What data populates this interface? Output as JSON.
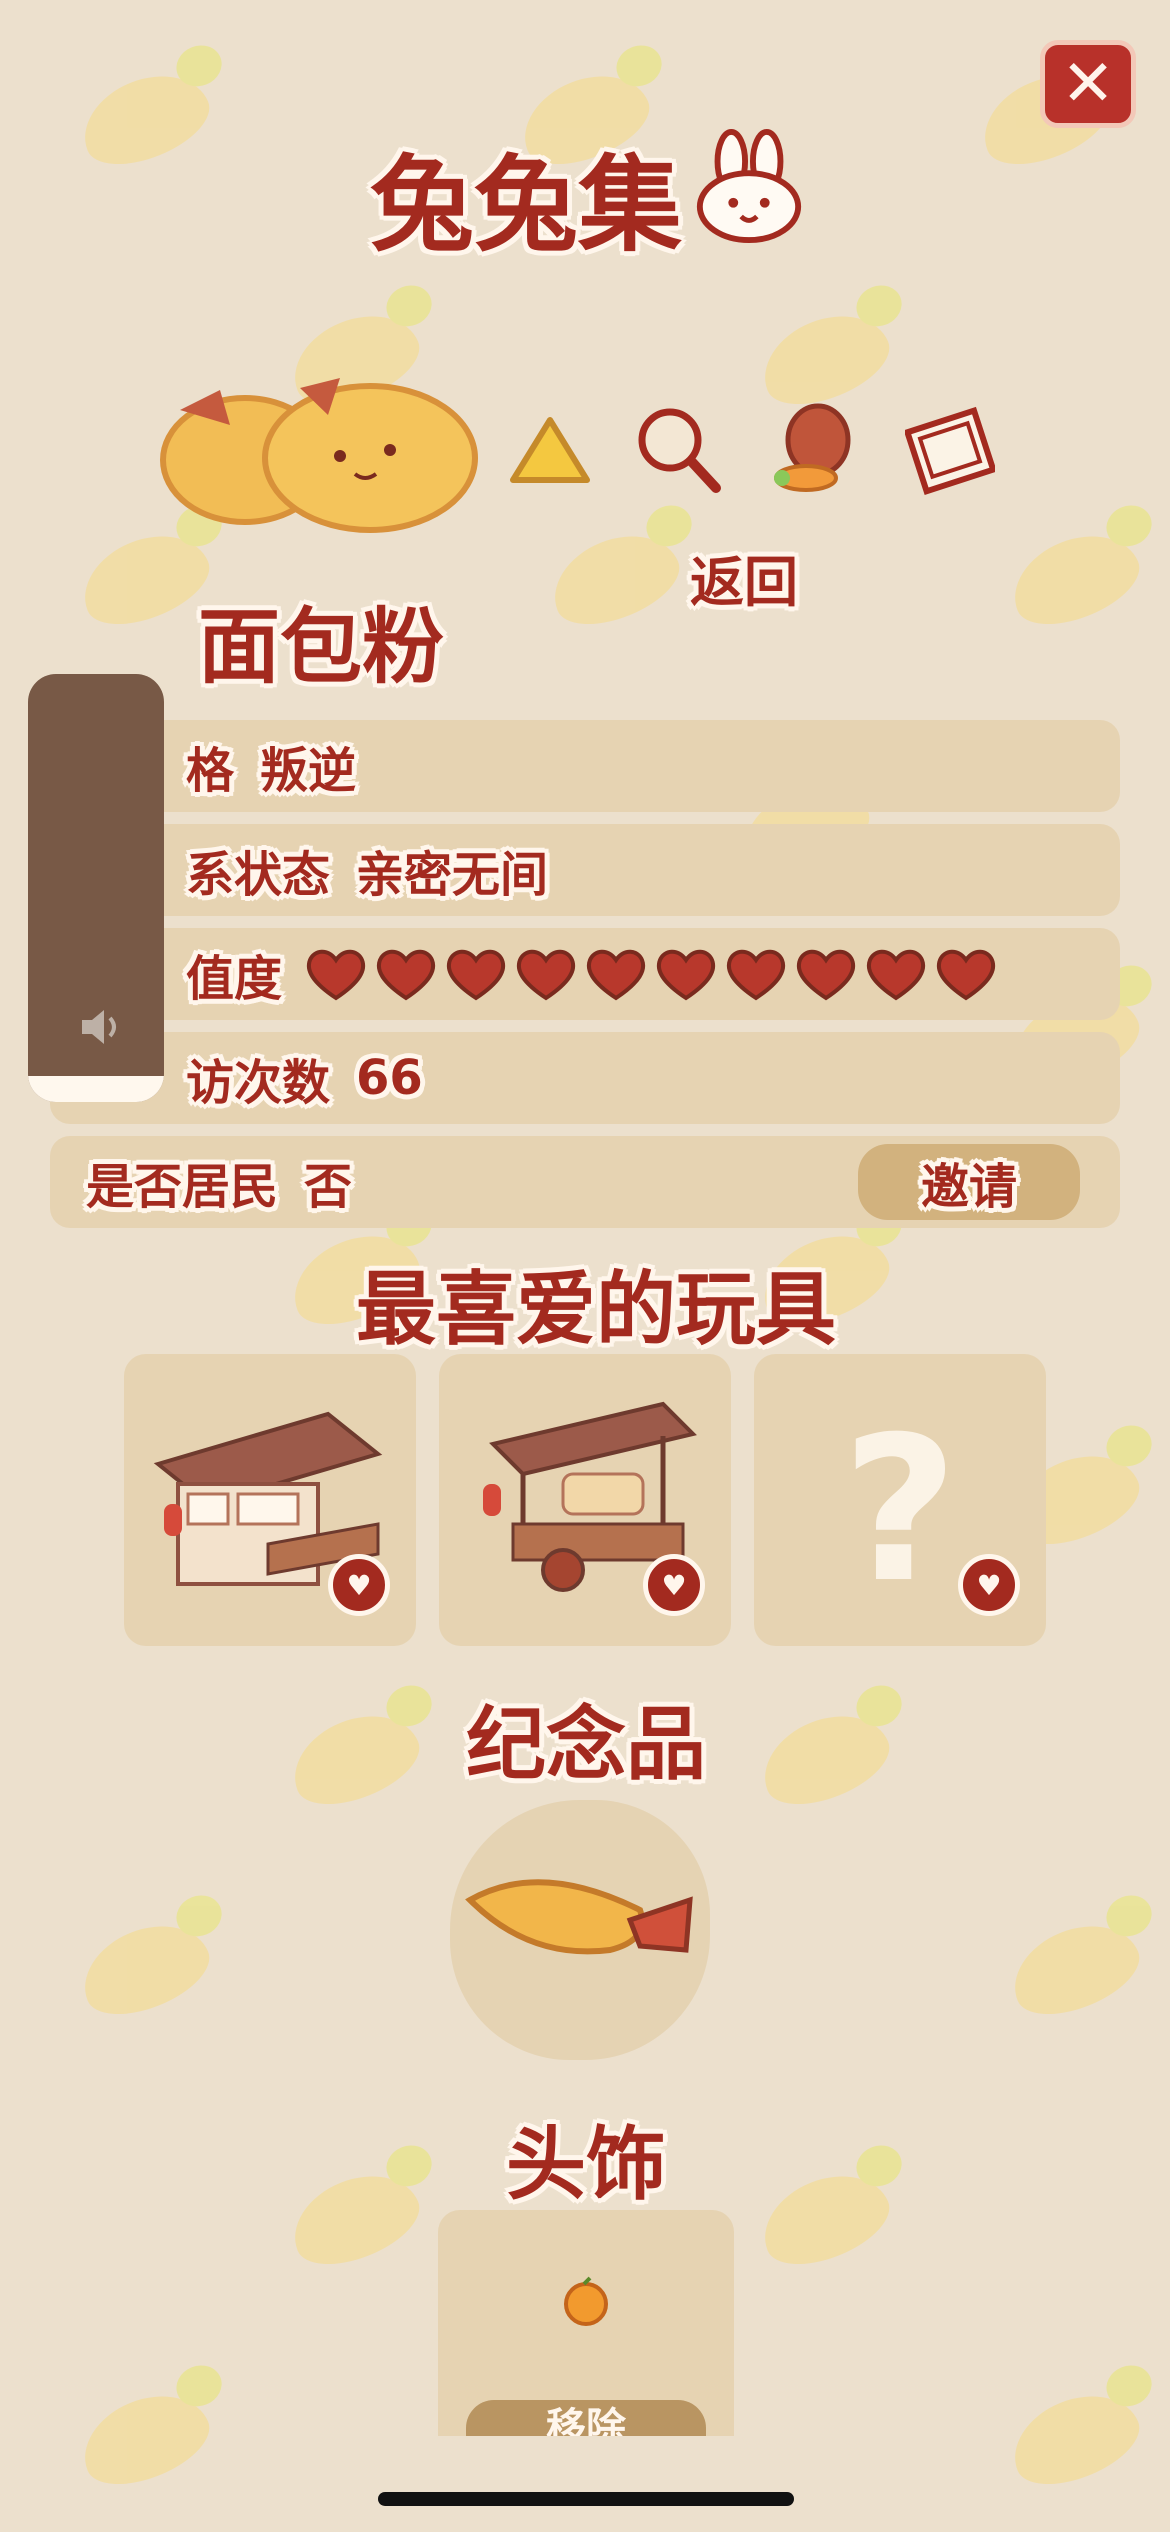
{
  "header": {
    "title": "兔兔集",
    "close_icon": "close-x-icon"
  },
  "character": {
    "name": "面包粉",
    "back_label": "返回",
    "tools": [
      "onigiri-icon",
      "magnifier-icon",
      "pinecone-carrot-icon",
      "photo-frame-icon"
    ]
  },
  "info_rows": {
    "personality": {
      "label": "格",
      "value": "叛逆"
    },
    "relationship": {
      "label": "系状态",
      "value": "亲密无间"
    },
    "affinity": {
      "label": "值度",
      "hearts": 10
    },
    "visits": {
      "label": "访次数",
      "value": "66"
    },
    "resident": {
      "label": "是否居民",
      "value": "否",
      "invite_label": "邀请"
    }
  },
  "volume": {
    "level": 0.06,
    "icon": "speaker-icon"
  },
  "favorite_toys": {
    "title": "最喜爱的玩具",
    "items": [
      {
        "name": "shop-stall",
        "unknown": false
      },
      {
        "name": "bun-cart",
        "unknown": false
      },
      {
        "name": "unknown",
        "unknown": true,
        "symbol": "?"
      }
    ]
  },
  "souvenir": {
    "title": "纪念品",
    "item": "fried-shrimp"
  },
  "headwear": {
    "title": "头饰",
    "item": "mini-orange",
    "remove_label": "移除"
  },
  "colors": {
    "accent": "#a32a1f",
    "background": "#ece0cd",
    "card": "#e6d3b2"
  }
}
